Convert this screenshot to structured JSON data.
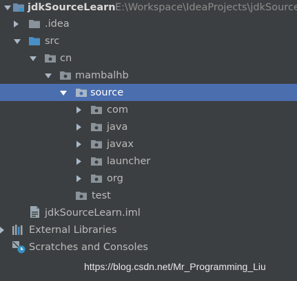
{
  "project": {
    "name": "jdkSourceLearn",
    "path": "E:\\Workspace\\IdeaProjects\\jdkSource"
  },
  "tree": {
    "idea": ".idea",
    "src": "src",
    "cn": "cn",
    "mambalhb": "mambalhb",
    "source": "source",
    "com": "com",
    "java": "java",
    "javax": "javax",
    "launcher": "launcher",
    "org": "org",
    "test": "test",
    "iml": "jdkSourceLearn.iml",
    "external_libraries": "External Libraries",
    "scratches": "Scratches and Consoles"
  },
  "watermark": "https://blog.csdn.net/Mr_Programming_Liu",
  "colors": {
    "background": "#3c3f41",
    "selection": "#4b6eaf",
    "folder": "#8a9399",
    "source_folder": "#4a90c8",
    "module_folder": "#6a8cae"
  }
}
